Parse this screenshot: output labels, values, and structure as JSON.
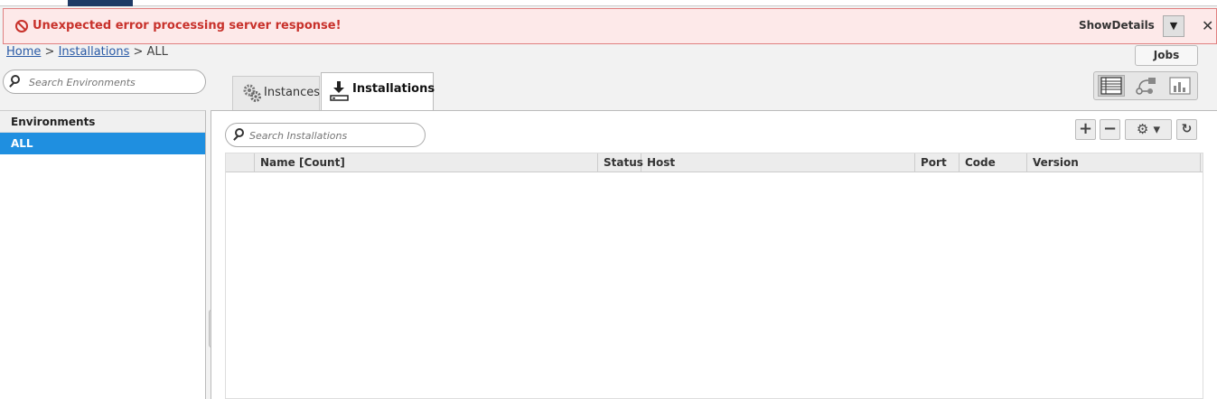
{
  "error_bar": {
    "message": "Unexpected error processing server response!",
    "show_details_label": "ShowDetails",
    "dropdown_glyph": "▼",
    "close_glyph": "✕"
  },
  "breadcrumb": {
    "home": "Home",
    "sep1": " > ",
    "installations": "Installations",
    "sep2": " > ",
    "current": "ALL"
  },
  "header": {
    "jobs_label": "Jobs"
  },
  "sidebar": {
    "search_placeholder": "Search Environments",
    "section_title": "Environments",
    "items": [
      {
        "label": "ALL",
        "selected": true
      }
    ]
  },
  "tabs": [
    {
      "label": "Instances",
      "icon": "gears-icon",
      "active": false
    },
    {
      "label": "Installations",
      "icon": "download-icon",
      "active": true
    }
  ],
  "main": {
    "search_placeholder": "Search Installations",
    "toolbar": {
      "add_glyph": "+",
      "remove_glyph": "−",
      "settings_glyph": "⚙ ▾",
      "refresh_glyph": "↻"
    },
    "grid": {
      "columns": [
        "Name [Count]",
        "Status",
        "Host",
        "Port",
        "Code",
        "Version"
      ],
      "rows": []
    }
  },
  "colors": {
    "error_text": "#c8312b",
    "selected_item_bg": "#1f8fe0",
    "link": "#2a5aa6"
  }
}
